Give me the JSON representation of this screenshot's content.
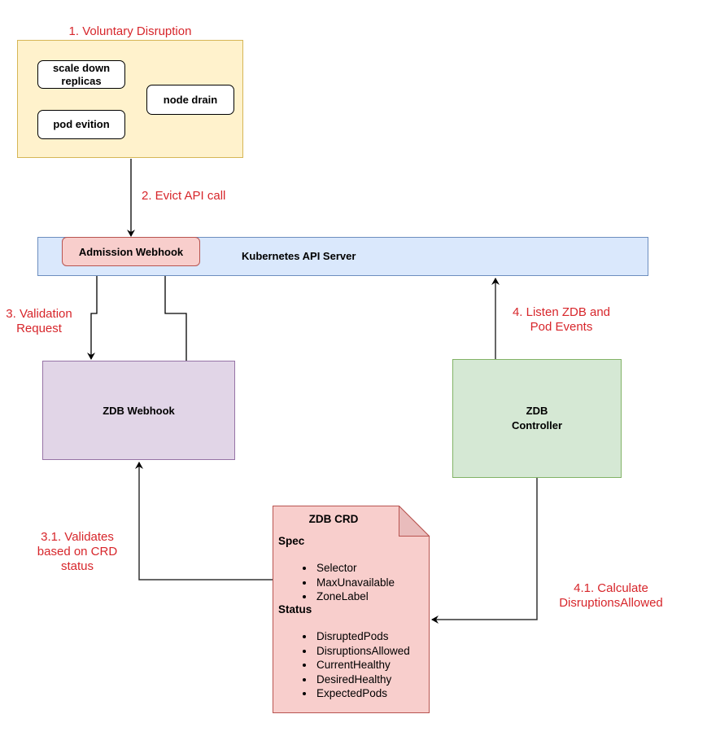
{
  "labels": {
    "voluntary_disruption": "1. Voluntary Disruption",
    "evict_api_call": "2. Evict API call",
    "validation_request_line1": "3. Validation",
    "validation_request_line2": "Request",
    "listen_events_line1": "4. Listen ZDB and",
    "listen_events_line2": "Pod Events",
    "validates_line1": "3.1. Validates",
    "validates_line2": "based on CRD",
    "validates_line3": "status",
    "calculate_line1": "4.1. Calculate",
    "calculate_line2": "DisruptionsAllowed"
  },
  "disruption_sources": {
    "scale_down_line1": "scale down",
    "scale_down_line2": "replicas",
    "node_drain": "node drain",
    "pod_eviction": "pod evition"
  },
  "api_server": {
    "title": "Kubernetes API Server",
    "admission_webhook": "Admission Webhook"
  },
  "zdb_webhook": {
    "title": "ZDB Webhook"
  },
  "zdb_controller": {
    "title_line1": "ZDB",
    "title_line2": "Controller"
  },
  "zdb_crd": {
    "title": "ZDB CRD",
    "spec_heading": "Spec",
    "spec_items": [
      "Selector",
      "MaxUnavailable",
      "ZoneLabel"
    ],
    "status_heading": "Status",
    "status_items": [
      "DisruptedPods",
      "DisruptionsAllowed",
      "CurrentHealthy",
      "DesiredHealthy",
      "ExpectedPods"
    ]
  },
  "colors": {
    "label_red": "#d7262b",
    "voluntary_fill": "#fff2cc",
    "voluntary_stroke": "#d6b656",
    "api_fill": "#dae8fc",
    "api_stroke": "#6c8ebf",
    "admission_fill": "#f8cecc",
    "admission_stroke": "#b85450",
    "webhook_fill": "#e1d5e7",
    "webhook_stroke": "#9673a6",
    "controller_fill": "#d5e8d4",
    "controller_stroke": "#82b366",
    "crd_fill": "#f8cecc",
    "crd_stroke": "#b85450"
  }
}
